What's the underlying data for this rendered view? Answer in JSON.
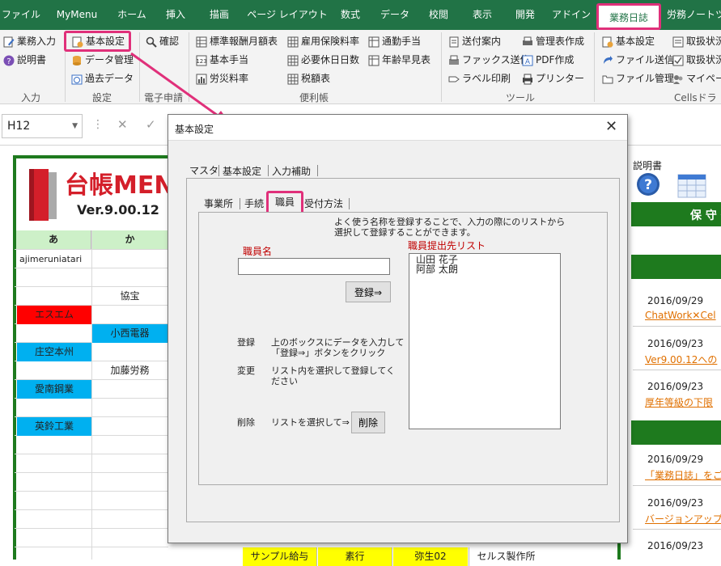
{
  "ribbon_tabs": [
    {
      "label": "ファイル"
    },
    {
      "label": "MyMenu"
    },
    {
      "label": "ホーム"
    },
    {
      "label": "挿入"
    },
    {
      "label": "描画"
    },
    {
      "label": "ページ レイアウト"
    },
    {
      "label": "数式"
    },
    {
      "label": "データ"
    },
    {
      "label": "校閲"
    },
    {
      "label": "表示"
    },
    {
      "label": "開発"
    },
    {
      "label": "アドイン"
    },
    {
      "label": "業務日誌"
    },
    {
      "label": "労務ノートツ"
    }
  ],
  "ribbon": {
    "input_group": {
      "items": [
        "業務入力",
        "説明書"
      ],
      "label": "入力"
    },
    "settings_group": {
      "items": [
        "基本設定",
        "データ管理",
        "過去データ"
      ],
      "label": "設定"
    },
    "eapply_group": {
      "items": [
        "確認"
      ],
      "label": "電子申請"
    },
    "convenience_group": {
      "items": [
        "標準報酬月額表",
        "基本手当",
        "労災料率",
        "雇用保険料率",
        "必要休日日数",
        "税額表",
        "通勤手当",
        "年齢早見表"
      ],
      "label": "便利帳"
    },
    "tools_group": {
      "items": [
        "送付案内",
        "ファックス送信",
        "ラベル印刷",
        "管理表作成",
        "PDF作成",
        "プリンター"
      ],
      "label": "ツール"
    },
    "cells_group": {
      "items": [
        "基本設定",
        "ファイル送信",
        "ファイル管理",
        "取扱状況",
        "取扱状況",
        "マイページ"
      ],
      "label": "Cellsドラ"
    }
  },
  "formula_bar": {
    "name_box": "H12"
  },
  "sheet": {
    "logo_title": "台帳MEN",
    "version": "Ver.9.00.12",
    "headers": [
      "あ",
      "か"
    ],
    "col_a": [
      {
        "text": "ajimeruniatari",
        "bg": ""
      },
      {
        "text": "",
        "bg": ""
      },
      {
        "text": "",
        "bg": ""
      },
      {
        "text": "エスエム",
        "bg": "#ff0000"
      },
      {
        "text": "",
        "bg": ""
      },
      {
        "text": "庄空本州",
        "bg": "#00b0f0"
      },
      {
        "text": "",
        "bg": ""
      },
      {
        "text": "愛南鋼業",
        "bg": "#00b0f0"
      },
      {
        "text": "",
        "bg": ""
      },
      {
        "text": "英鈴工業",
        "bg": "#00b0f0"
      }
    ],
    "col_b": [
      {
        "text": "",
        "bg": ""
      },
      {
        "text": "",
        "bg": ""
      },
      {
        "text": "協宝",
        "bg": ""
      },
      {
        "text": "",
        "bg": ""
      },
      {
        "text": "小西電器",
        "bg": "#00b0f0"
      },
      {
        "text": "",
        "bg": ""
      },
      {
        "text": "加藤労務",
        "bg": ""
      }
    ],
    "bottom_row": [
      "サンプル給与",
      "素行",
      "弥生02",
      "セルス製作所"
    ],
    "right_manual": "説明書",
    "right_header": "保 守 情",
    "news": [
      {
        "date": "2016/09/29",
        "title": "ChatWork✕Cel"
      },
      {
        "date": "2016/09/23",
        "title": "Ver9.00.12への"
      },
      {
        "date": "2016/09/23",
        "title": "厚年等級の下限"
      },
      {
        "date": "2016/09/29",
        "title": "「業務日誌」をご"
      },
      {
        "date": "2016/09/23",
        "title": "バージョンアップ"
      },
      {
        "date": "2016/09/23",
        "title": ""
      }
    ]
  },
  "dialog": {
    "title": "基本設定",
    "outer_tabs": [
      "マスタ",
      "基本設定",
      "入力補助"
    ],
    "inner_tabs": [
      "事業所",
      "手続",
      "職員",
      "受付方法"
    ],
    "description": "よく使う名称を登録することで、入力の際にのリストから\n選択して登録することができます。",
    "name_label": "職員名",
    "name_value": "",
    "register_button": "登録⇒",
    "list_label": "職員提出先リスト",
    "list_items": [
      "山田 花子",
      "阿部 太朗"
    ],
    "help": [
      {
        "key": "登録",
        "text": "上のボックスにデータを入力して\n「登録⇒」ボタンをクリック"
      },
      {
        "key": "変更",
        "text": "リスト内を選択して登録してく\nださい"
      }
    ],
    "delete_key": "削除",
    "delete_text": "リストを選択して⇒",
    "delete_button": "削除"
  },
  "colors": {
    "excel_green": "#217346",
    "highlight": "#e0307a",
    "sheet_border": "#1e7a1e",
    "header_green": "#cdf0c8",
    "link_orange": "#e07000"
  }
}
